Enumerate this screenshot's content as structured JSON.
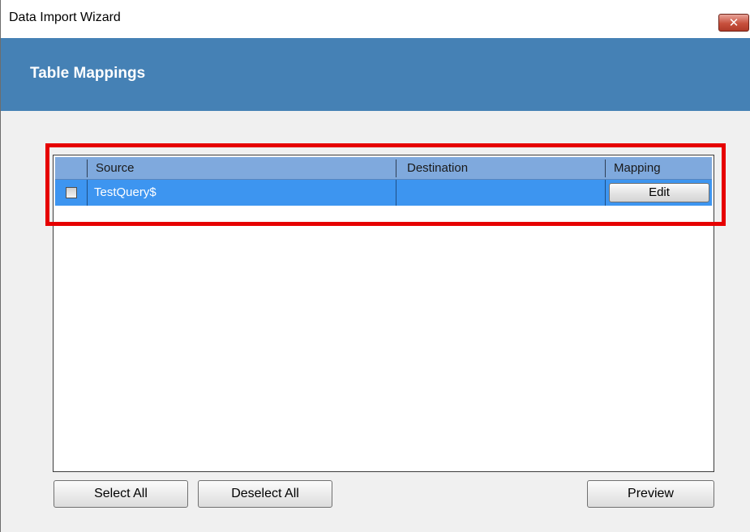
{
  "window": {
    "title": "Data Import Wizard",
    "close_glyph": "✕"
  },
  "header": {
    "title": "Table Mappings"
  },
  "grid": {
    "columns": {
      "source": "Source",
      "destination": "Destination",
      "mapping": "Mapping"
    },
    "rows": [
      {
        "checked": false,
        "source": "TestQuery$",
        "destination": "",
        "mapping_button": "Edit",
        "selected": true
      }
    ]
  },
  "buttons": {
    "select_all": "Select All",
    "deselect_all": "Deselect All",
    "preview": "Preview"
  },
  "icons": {
    "close": "close-icon",
    "checkbox": "checkbox-icon"
  },
  "colors": {
    "header_band": "#4581b5",
    "grid_header": "#7fa9dd",
    "selected_row": "#3d95f0",
    "highlight": "#e60000"
  }
}
